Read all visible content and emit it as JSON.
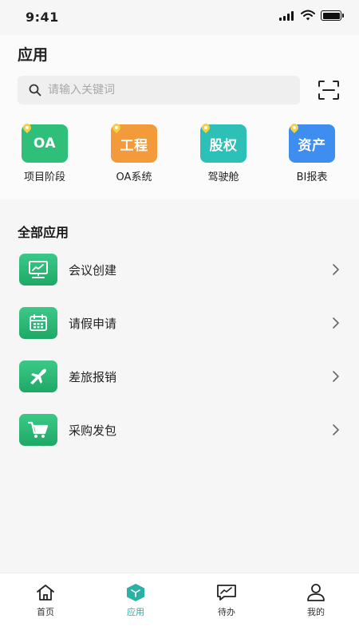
{
  "status_bar": {
    "time": "9:41"
  },
  "page": {
    "title": "应用"
  },
  "search": {
    "placeholder": "请输入关键词"
  },
  "quick_apps": [
    {
      "tile_text": "OA",
      "label": "项目阶段",
      "color": "#2fbf7a"
    },
    {
      "tile_text": "工程",
      "label": "OA系统",
      "color": "#f39a3a"
    },
    {
      "tile_text": "股权",
      "label": "驾驶舱",
      "color": "#2cc0b6"
    },
    {
      "tile_text": "资产",
      "label": "BI报表",
      "color": "#3d8ef0"
    }
  ],
  "all_apps": {
    "title": "全部应用",
    "items": [
      {
        "label": "会议创建",
        "icon": "presentation-board-icon"
      },
      {
        "label": "请假申请",
        "icon": "calendar-icon"
      },
      {
        "label": "差旅报销",
        "icon": "airplane-icon"
      },
      {
        "label": "采购发包",
        "icon": "shopping-cart-icon"
      }
    ]
  },
  "tab_bar": {
    "items": [
      {
        "label": "首页",
        "icon": "home-icon",
        "active": false
      },
      {
        "label": "应用",
        "icon": "apps-cube-icon",
        "active": true
      },
      {
        "label": "待办",
        "icon": "chart-message-icon",
        "active": false
      },
      {
        "label": "我的",
        "icon": "user-icon",
        "active": false
      }
    ]
  },
  "colors": {
    "accent": "#2bb0a6",
    "app_icon_green": "#2bbd7a"
  }
}
